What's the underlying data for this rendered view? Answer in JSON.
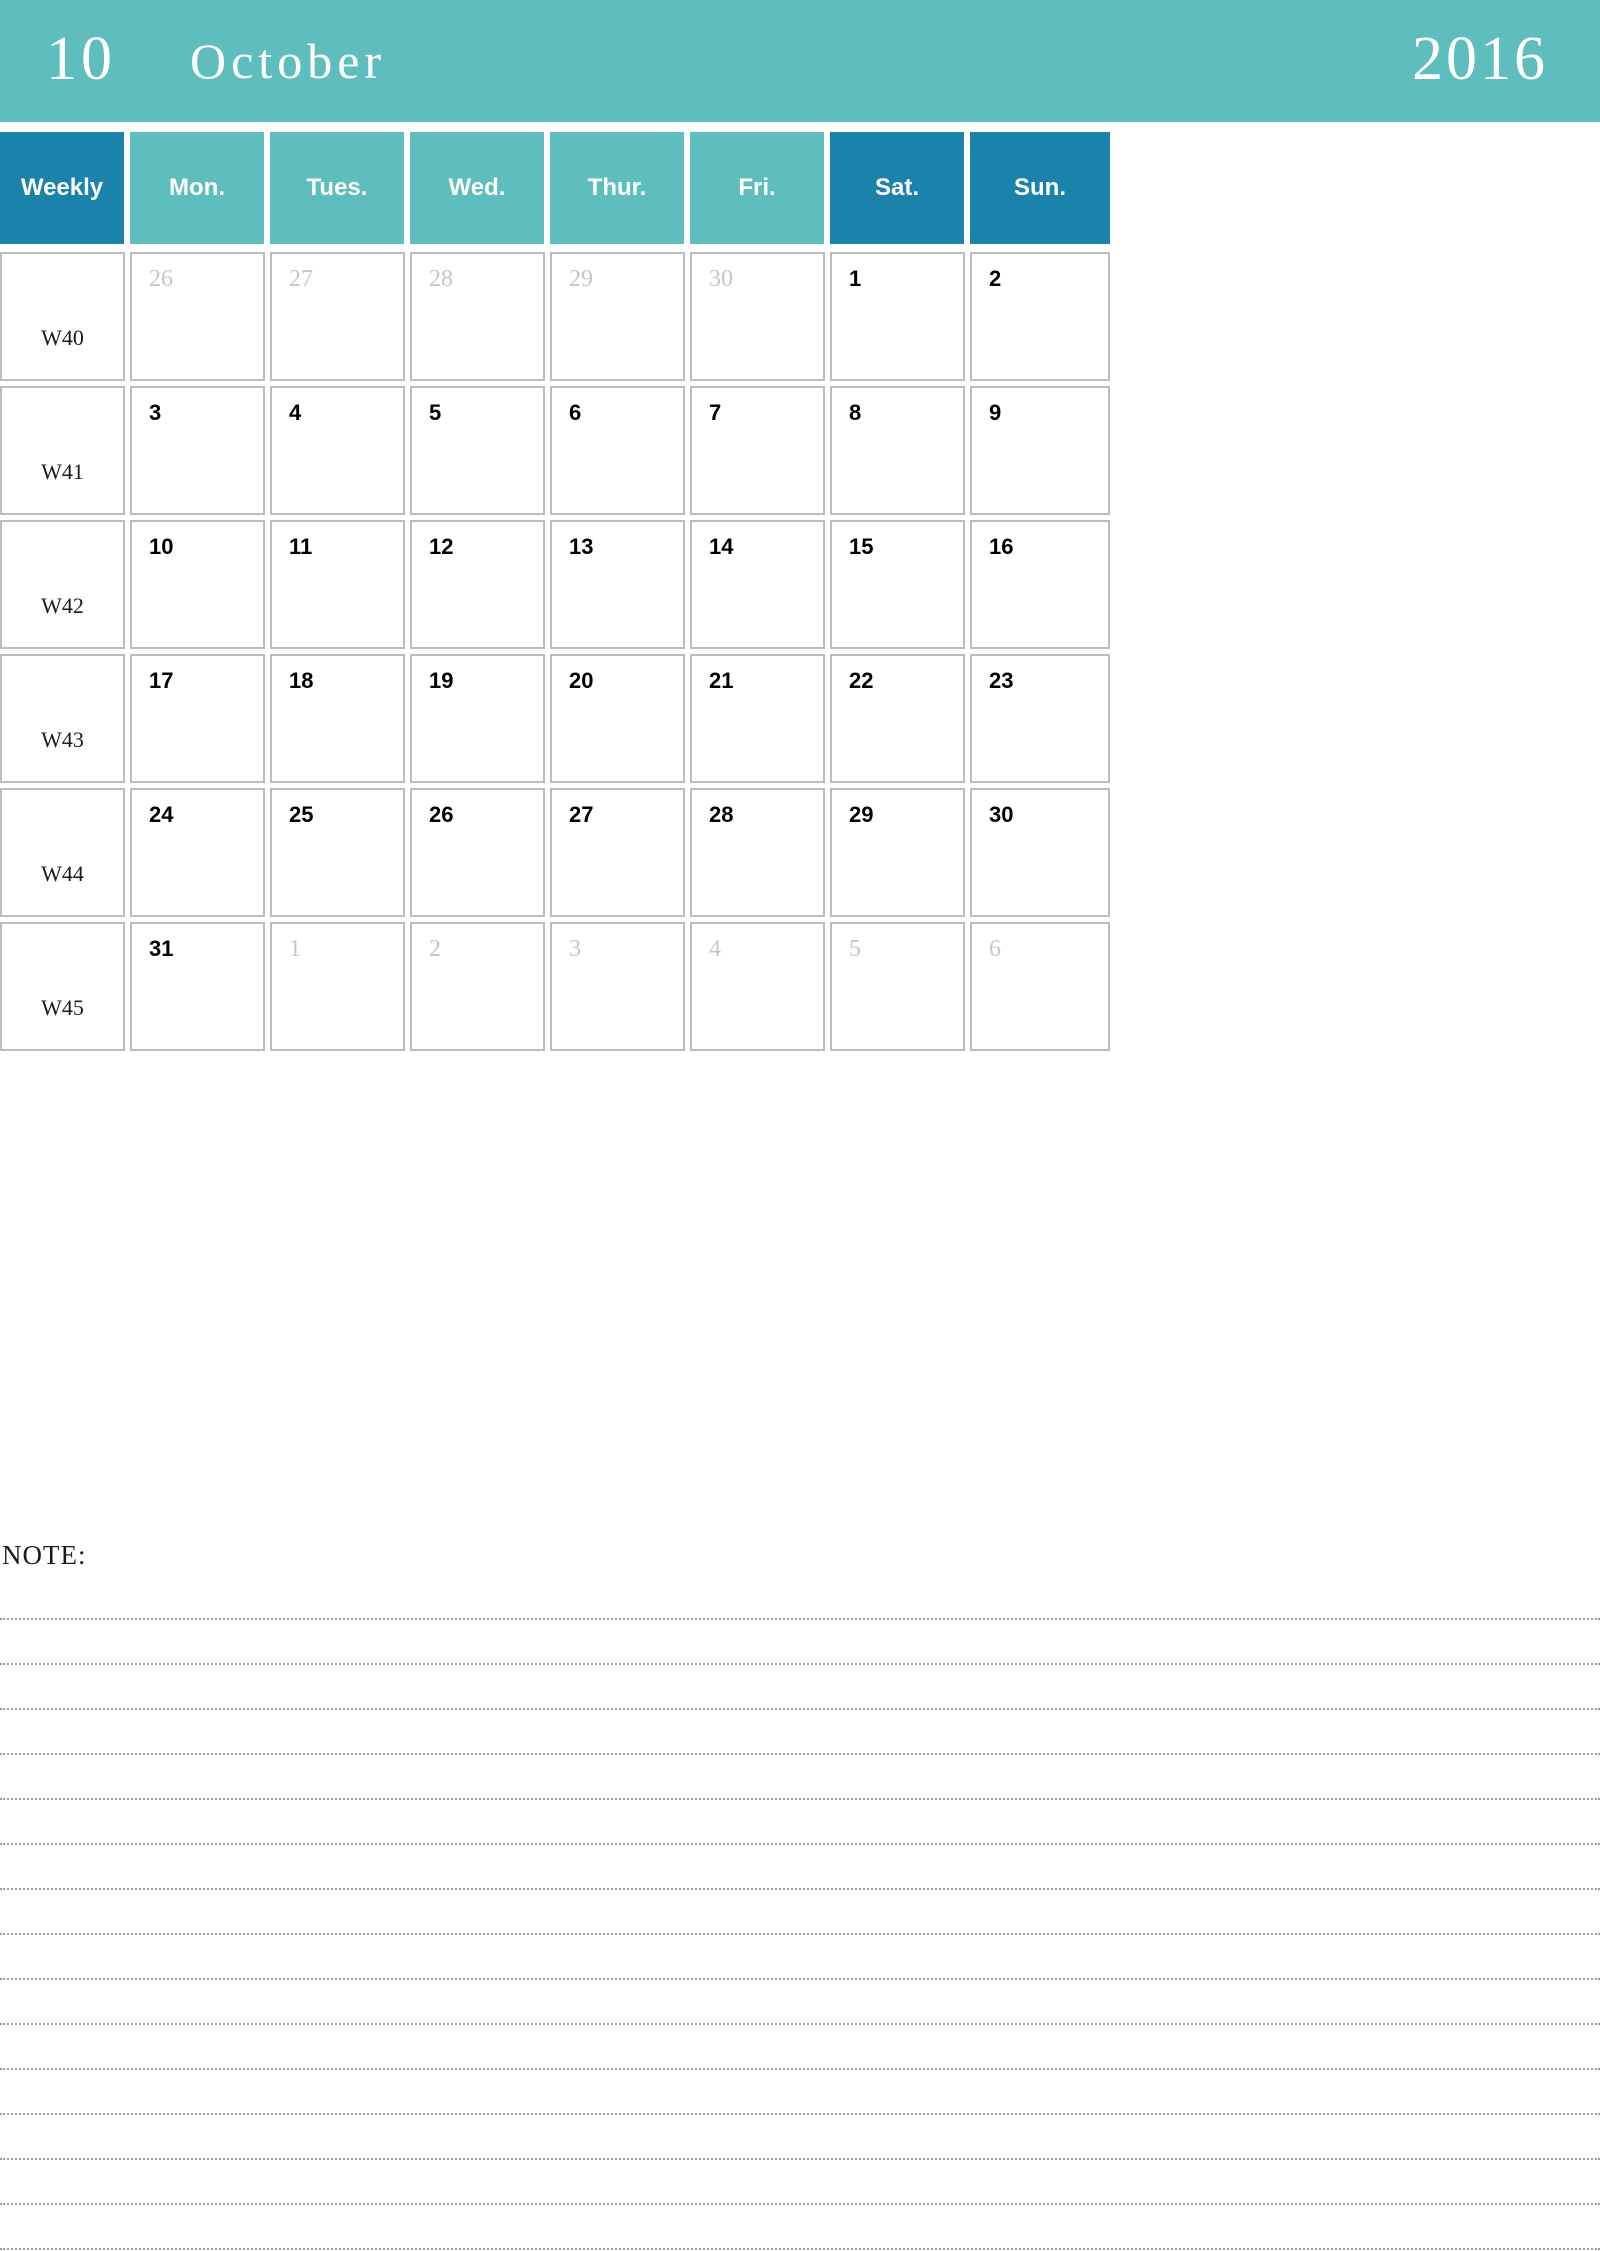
{
  "header": {
    "month_number": "10",
    "month_name": "October",
    "year": "2016",
    "bar_color": "#5ebebd",
    "accent_color": "#1a82ab"
  },
  "columns": [
    {
      "label": "Weekly",
      "accent": true
    },
    {
      "label": "Mon.",
      "accent": false
    },
    {
      "label": "Tues.",
      "accent": false
    },
    {
      "label": "Wed.",
      "accent": false
    },
    {
      "label": "Thur.",
      "accent": false
    },
    {
      "label": "Fri.",
      "accent": false
    },
    {
      "label": "Sat.",
      "accent": true
    },
    {
      "label": "Sun.",
      "accent": true
    }
  ],
  "weeks": [
    {
      "week_label": "W40",
      "days": [
        {
          "num": "26",
          "muted": true
        },
        {
          "num": "27",
          "muted": true
        },
        {
          "num": "28",
          "muted": true
        },
        {
          "num": "29",
          "muted": true
        },
        {
          "num": "30",
          "muted": true
        },
        {
          "num": "1",
          "muted": false
        },
        {
          "num": "2",
          "muted": false
        }
      ]
    },
    {
      "week_label": "W41",
      "days": [
        {
          "num": "3",
          "muted": false
        },
        {
          "num": "4",
          "muted": false
        },
        {
          "num": "5",
          "muted": false
        },
        {
          "num": "6",
          "muted": false
        },
        {
          "num": "7",
          "muted": false
        },
        {
          "num": "8",
          "muted": false
        },
        {
          "num": "9",
          "muted": false
        }
      ]
    },
    {
      "week_label": "W42",
      "days": [
        {
          "num": "10",
          "muted": false
        },
        {
          "num": "11",
          "muted": false
        },
        {
          "num": "12",
          "muted": false
        },
        {
          "num": "13",
          "muted": false
        },
        {
          "num": "14",
          "muted": false
        },
        {
          "num": "15",
          "muted": false
        },
        {
          "num": "16",
          "muted": false
        }
      ]
    },
    {
      "week_label": "W43",
      "days": [
        {
          "num": "17",
          "muted": false
        },
        {
          "num": "18",
          "muted": false
        },
        {
          "num": "19",
          "muted": false
        },
        {
          "num": "20",
          "muted": false
        },
        {
          "num": "21",
          "muted": false
        },
        {
          "num": "22",
          "muted": false
        },
        {
          "num": "23",
          "muted": false
        }
      ]
    },
    {
      "week_label": "W44",
      "days": [
        {
          "num": "24",
          "muted": false
        },
        {
          "num": "25",
          "muted": false
        },
        {
          "num": "26",
          "muted": false
        },
        {
          "num": "27",
          "muted": false
        },
        {
          "num": "28",
          "muted": false
        },
        {
          "num": "29",
          "muted": false
        },
        {
          "num": "30",
          "muted": false
        }
      ]
    },
    {
      "week_label": "W45",
      "days": [
        {
          "num": "31",
          "muted": false
        },
        {
          "num": "1",
          "muted": true
        },
        {
          "num": "2",
          "muted": true
        },
        {
          "num": "3",
          "muted": true
        },
        {
          "num": "4",
          "muted": true
        },
        {
          "num": "5",
          "muted": true
        },
        {
          "num": "6",
          "muted": true
        }
      ]
    }
  ],
  "note": {
    "label": "NOTE:",
    "line_count": 15
  }
}
